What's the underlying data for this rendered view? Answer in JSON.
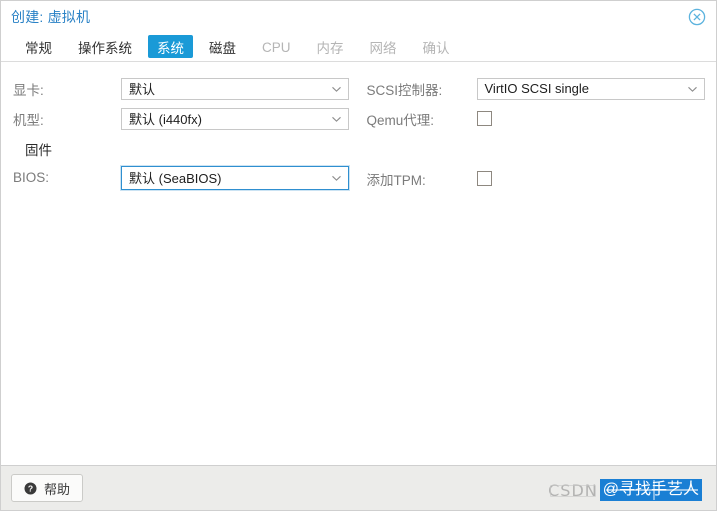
{
  "window": {
    "title": "创建: 虚拟机",
    "close_icon": "close-circle-icon"
  },
  "tabs": [
    {
      "label": "常规",
      "state": "normal"
    },
    {
      "label": "操作系统",
      "state": "normal"
    },
    {
      "label": "系统",
      "state": "active"
    },
    {
      "label": "磁盘",
      "state": "normal"
    },
    {
      "label": "CPU",
      "state": "disabled"
    },
    {
      "label": "内存",
      "state": "disabled"
    },
    {
      "label": "网络",
      "state": "disabled"
    },
    {
      "label": "确认",
      "state": "disabled"
    }
  ],
  "form": {
    "left": {
      "graphics_label": "显卡:",
      "graphics_value": "默认",
      "machine_label": "机型:",
      "machine_value": "默认 (i440fx)",
      "firmware_section": "固件",
      "bios_label": "BIOS:",
      "bios_value": "默认 (SeaBIOS)"
    },
    "right": {
      "scsi_label": "SCSI控制器:",
      "scsi_value": "VirtIO SCSI single",
      "qemu_agent_label": "Qemu代理:",
      "qemu_agent_checked": false,
      "tpm_label": "添加TPM:",
      "tpm_checked": false
    }
  },
  "footer": {
    "help_label": "帮助",
    "help_icon": "question-mark-icon"
  },
  "watermark": {
    "site": "CSDN",
    "handle": "@寻找手艺人"
  },
  "colors": {
    "title": "#2a82c6",
    "tab_active_bg": "#1a9ad7",
    "tab_disabled": "#b5b5b5",
    "label": "#7b7b7b",
    "focus_border": "#2f8fd0",
    "footer_bg": "#ececea",
    "watermark_badge": "#1a7fd4"
  }
}
